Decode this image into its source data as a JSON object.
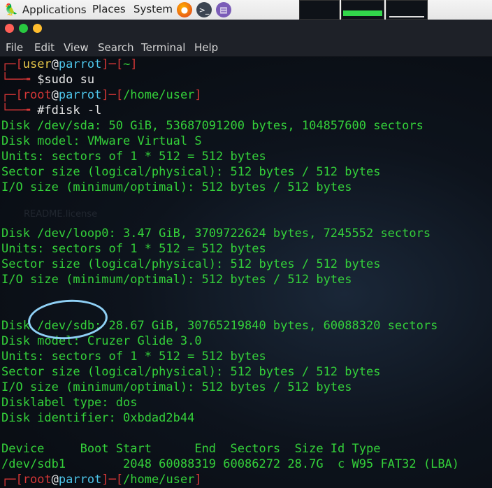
{
  "top_panel": {
    "applications": "Applications",
    "places": "Places",
    "system": "System"
  },
  "menubar": [
    "File",
    "Edit",
    "View",
    "Search",
    "Terminal",
    "Help"
  ],
  "desktop_ghost_text": [
    "README.license"
  ],
  "terminal": {
    "prompt1": {
      "user": "user",
      "at": "@",
      "host": "parrot",
      "dir": "~",
      "command": "$sudo su"
    },
    "prompt2": {
      "user": "root",
      "at": "@",
      "host": "parrot",
      "dir": "/home/user",
      "command": "#fdisk -l"
    },
    "output": [
      "Disk /dev/sda: 50 GiB, 53687091200 bytes, 104857600 sectors",
      "Disk model: VMware Virtual S",
      "Units: sectors of 1 * 512 = 512 bytes",
      "Sector size (logical/physical): 512 bytes / 512 bytes",
      "I/O size (minimum/optimal): 512 bytes / 512 bytes",
      "",
      "",
      "Disk /dev/loop0: 3.47 GiB, 3709722624 bytes, 7245552 sectors",
      "Units: sectors of 1 * 512 = 512 bytes",
      "Sector size (logical/physical): 512 bytes / 512 bytes",
      "I/O size (minimum/optimal): 512 bytes / 512 bytes",
      "",
      "",
      "Disk /dev/sdb: 28.67 GiB, 30765219840 bytes, 60088320 sectors",
      "Disk model: Cruzer Glide 3.0",
      "Units: sectors of 1 * 512 = 512 bytes",
      "Sector size (logical/physical): 512 bytes / 512 bytes",
      "I/O size (minimum/optimal): 512 bytes / 512 bytes",
      "Disklabel type: dos",
      "Disk identifier: 0xbdad2b44",
      "",
      "Device     Boot Start      End  Sectors  Size Id Type",
      "/dev/sdb1        2048 60088319 60086272 28.7G  c W95 FAT32 (LBA)"
    ],
    "prompt3": {
      "user": "root",
      "at": "@",
      "host": "parrot",
      "dir": "/home/user"
    }
  },
  "colors": {
    "prompt_bracket": "#d63737",
    "prompt_user": "#e8c84a",
    "prompt_host": "#4ec7ec",
    "output_text": "#34d13a",
    "annotation_circle": "#8fd0f5"
  }
}
